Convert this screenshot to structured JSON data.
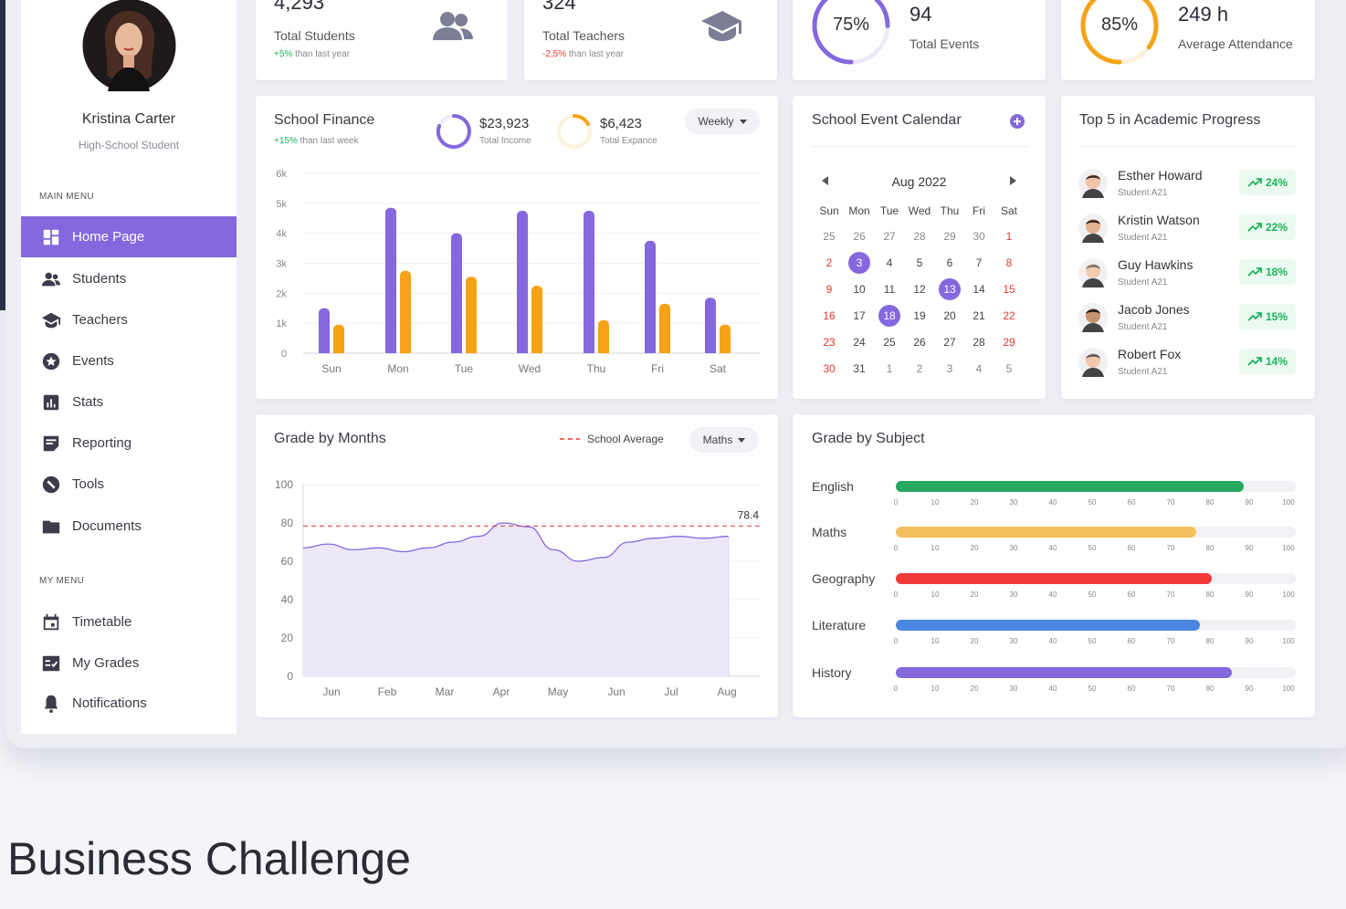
{
  "profile": {
    "name": "Kristina Carter",
    "role": "High-School Student"
  },
  "main_menu": {
    "title": "MAIN MENU",
    "items": [
      {
        "label": "Home Page",
        "icon": "dashboard-icon"
      },
      {
        "label": "Students",
        "icon": "students-icon"
      },
      {
        "label": "Teachers",
        "icon": "teachers-icon"
      },
      {
        "label": "Events",
        "icon": "events-icon"
      },
      {
        "label": "Stats",
        "icon": "stats-icon"
      },
      {
        "label": "Reporting",
        "icon": "reporting-icon"
      },
      {
        "label": "Tools",
        "icon": "tools-icon"
      },
      {
        "label": "Documents",
        "icon": "documents-icon"
      }
    ]
  },
  "my_menu": {
    "title": "MY MENU",
    "items": [
      {
        "label": "Timetable",
        "icon": "calendar-icon"
      },
      {
        "label": "My Grades",
        "icon": "grades-icon"
      },
      {
        "label": "Notifications",
        "icon": "bell-icon"
      }
    ]
  },
  "stats": {
    "students": {
      "value": "4,293",
      "label": "Total Students",
      "delta": "+5%",
      "delta_text": "than last year"
    },
    "teachers": {
      "value": "324",
      "label": "Total Teachers",
      "delta": "-2,5%",
      "delta_text": "than last year"
    },
    "events": {
      "percent": "75%",
      "percent_value": 75,
      "value": "94",
      "label": "Total Events"
    },
    "attendance": {
      "percent": "85%",
      "percent_value": 85,
      "value": "249 h",
      "label": "Average Attendance"
    }
  },
  "finance": {
    "title": "School Finance",
    "delta": "+15%",
    "delta_text": "than last week",
    "income_value": "$23,923",
    "income_label": "Total Income",
    "expense_value": "$6,423",
    "expense_label": "Total Expance",
    "period": "Weekly",
    "colors": {
      "income": "#8568de",
      "expense": "#f6a317"
    }
  },
  "calendar": {
    "title": "School Event Calendar",
    "month": "Aug 2022",
    "weekdays": [
      "Sun",
      "Mon",
      "Tue",
      "Wed",
      "Thu",
      "Fri",
      "Sat"
    ],
    "weeks": [
      [
        "25",
        "26",
        "27",
        "28",
        "29",
        "30",
        "1"
      ],
      [
        "2",
        "3",
        "4",
        "5",
        "6",
        "7",
        "8"
      ],
      [
        "9",
        "10",
        "11",
        "12",
        "13",
        "14",
        "15"
      ],
      [
        "16",
        "17",
        "18",
        "19",
        "20",
        "21",
        "22"
      ],
      [
        "23",
        "24",
        "25",
        "26",
        "27",
        "28",
        "29"
      ],
      [
        "30",
        "31",
        "1",
        "2",
        "3",
        "4",
        "5"
      ]
    ],
    "highlighted": [
      "3",
      "13",
      "18"
    ]
  },
  "top5": {
    "title": "Top 5 in Academic Progress",
    "students": [
      {
        "name": "Esther Howard",
        "class": "Student A21",
        "progress": "24%"
      },
      {
        "name": "Kristin Watson",
        "class": "Student A21",
        "progress": "22%"
      },
      {
        "name": "Guy Hawkins",
        "class": "Student A21",
        "progress": "18%"
      },
      {
        "name": "Jacob Jones",
        "class": "Student A21",
        "progress": "15%"
      },
      {
        "name": "Robert Fox",
        "class": "Student A21",
        "progress": "14%"
      }
    ]
  },
  "grade_months": {
    "title": "Grade by Months",
    "legend": "School Average",
    "subject": "Maths",
    "average_label": "78.4"
  },
  "grade_subject": {
    "title": "Grade by Subject",
    "ticks": [
      "0",
      "10",
      "20",
      "30",
      "40",
      "50",
      "60",
      "70",
      "80",
      "90",
      "100"
    ]
  },
  "chart_data": [
    {
      "type": "bar",
      "categories": [
        "Sun",
        "Mon",
        "Tue",
        "Wed",
        "Thu",
        "Fri",
        "Sat"
      ],
      "series": [
        {
          "values": [
            1.5,
            4.85,
            4.0,
            4.75,
            4.75,
            3.75,
            1.85
          ]
        },
        {
          "values": [
            0.95,
            2.75,
            2.55,
            2.25,
            1.1,
            1.65,
            0.95
          ]
        }
      ],
      "yticks": [
        "0",
        "1k",
        "2k",
        "3k",
        "4k",
        "5k",
        "6k"
      ],
      "ylim": [
        0,
        6
      ]
    },
    {
      "type": "area",
      "categories": [
        "Jun",
        "Feb",
        "Mar",
        "Apr",
        "May",
        "Jun",
        "Jul",
        "Aug"
      ],
      "values": [
        67,
        69,
        66,
        67,
        65,
        67,
        70,
        73,
        80,
        78,
        66,
        60,
        62,
        70,
        72,
        73,
        72,
        73
      ],
      "reference_line": 78.4,
      "yticks": [
        "0",
        "20",
        "40",
        "60",
        "80",
        "100"
      ],
      "ylim": [
        0,
        100
      ]
    },
    {
      "type": "bar",
      "orientation": "horizontal",
      "categories": [
        "English",
        "Maths",
        "Geography",
        "Literature",
        "History"
      ],
      "values": [
        87,
        75,
        79,
        76,
        84
      ],
      "colors": [
        "#27a960",
        "#f3c15c",
        "#f03a3a",
        "#4b86e0",
        "#8568de"
      ],
      "xlim": [
        0,
        100
      ]
    }
  ],
  "footer": {
    "heading": "Business Challenge"
  }
}
